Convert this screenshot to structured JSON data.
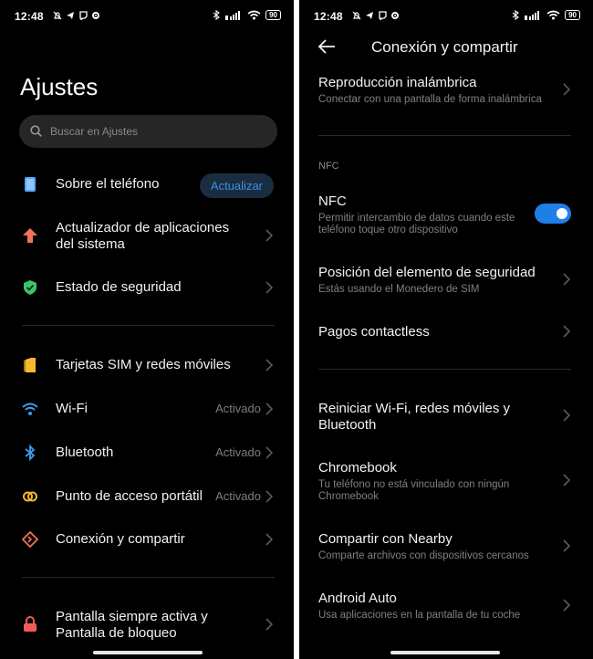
{
  "left": {
    "status": {
      "time": "12:48",
      "battery": "90"
    },
    "title": "Ajustes",
    "search": {
      "placeholder": "Buscar en Ajustes"
    },
    "items": [
      {
        "label": "Sobre el teléfono",
        "pill": "Actualizar",
        "icon": "phone-icon"
      },
      {
        "label": "Actualizador de aplicaciones del sistema",
        "icon": "arrow-up-icon"
      },
      {
        "label": "Estado de seguridad",
        "icon": "shield-icon"
      },
      {
        "label": "Tarjetas SIM y redes móviles",
        "icon": "sim-card-icon"
      },
      {
        "label": "Wi-Fi",
        "value": "Activado",
        "icon": "wifi-icon"
      },
      {
        "label": "Bluetooth",
        "value": "Activado",
        "icon": "bluetooth-icon"
      },
      {
        "label": "Punto de acceso portátil",
        "value": "Activado",
        "icon": "hotspot-icon"
      },
      {
        "label": "Conexión y compartir",
        "icon": "connection-sharing-icon"
      },
      {
        "label": "Pantalla siempre activa y Pantalla de bloqueo",
        "icon": "lock-icon"
      }
    ]
  },
  "right": {
    "status": {
      "time": "12:48",
      "battery": "90"
    },
    "title": "Conexión y compartir",
    "section_nfc": "NFC",
    "items": [
      {
        "title": "Reproducción inalámbrica",
        "subtitle": "Conectar con una pantalla de forma inalámbrica"
      },
      {
        "title": "NFC",
        "subtitle": "Permitir intercambio de datos cuando este teléfono toque otro dispositivo",
        "toggle_on": true
      },
      {
        "title": "Posición del elemento de seguridad",
        "subtitle": "Estás usando el Monedero de SIM"
      },
      {
        "title": "Pagos contactless"
      },
      {
        "title": "Reiniciar Wi-Fi, redes móviles y Bluetooth"
      },
      {
        "title": "Chromebook",
        "subtitle": "Tu teléfono no está vinculado con ningún Chromebook"
      },
      {
        "title": "Compartir con Nearby",
        "subtitle": "Comparte archivos con dispositivos cercanos"
      },
      {
        "title": "Android Auto",
        "subtitle": "Usa aplicaciones en la pantalla de tu coche"
      }
    ]
  },
  "colors": {
    "background": "#000000",
    "accent": "#1f7ee8",
    "pill_bg": "#1a2c40",
    "secondary_text": "#808080"
  }
}
